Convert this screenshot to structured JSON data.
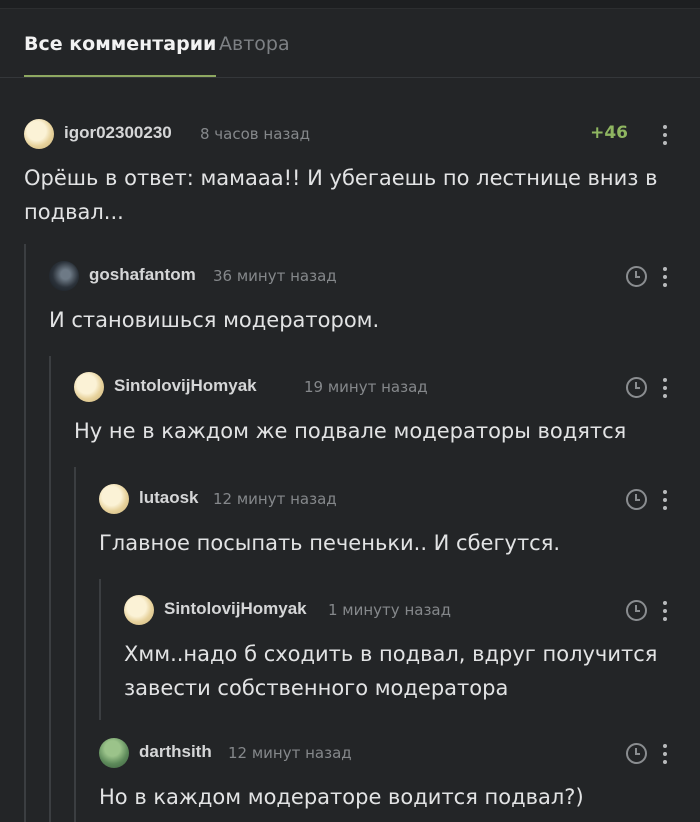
{
  "tabs": {
    "all": "Все комментарии",
    "author": "Автора"
  },
  "comments": [
    {
      "user": "igor02300230",
      "time": "8 часов назад",
      "score": "+46",
      "text": "Орёшь в ответ: мамааа!! И убегаешь по лестнице вниз в подвал...",
      "avatar": "cookie-avatar"
    },
    {
      "user": "goshafantom",
      "time": "36 минут назад",
      "text": "И становишься модератором.",
      "avatar": "dark-avatar"
    },
    {
      "user": "SintolovijHomyak",
      "time": "19 минут назад",
      "text": "Ну не в каждом же подвале модераторы водятся",
      "avatar": "cookie-avatar"
    },
    {
      "user": "lutaosk",
      "time": "12 минут назад",
      "text": "Главное посыпать печеньки.. И сбегутся.",
      "avatar": "cookie-avatar"
    },
    {
      "user": "SintolovijHomyak",
      "time": "1 минуту назад",
      "text": "Хмм..надо б сходить в подвал, вдруг получится завести собственного модератора",
      "avatar": "cookie-avatar"
    },
    {
      "user": "darthsith",
      "time": "12 минут назад",
      "text": "Но в каждом модераторе водится подвал?)",
      "avatar": "green-avatar"
    }
  ],
  "colors": {
    "background": "#232527",
    "accent": "#8ea861",
    "score": "#8fb661"
  },
  "icons": [
    "clock-icon",
    "more-vertical-icon"
  ]
}
